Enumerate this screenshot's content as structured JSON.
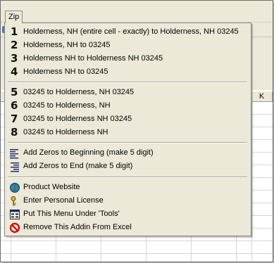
{
  "menubar": {
    "zip_label": "Zip"
  },
  "sheet": {
    "column_header_k": "K"
  },
  "menu": {
    "group1": [
      {
        "number": "1",
        "label": "Holderness, NH (entire cell - exactly) to Holderness, NH 03245"
      },
      {
        "number": "2",
        "label": "Holderness, NH to 03245"
      },
      {
        "number": "3",
        "label": "Holderness NH to Holderness NH 03245"
      },
      {
        "number": "4",
        "label": "Holderness NH to 03245"
      }
    ],
    "group2": [
      {
        "number": "5",
        "label": "03245 to Holderness, NH 03245"
      },
      {
        "number": "6",
        "label": "03245 to Holderness, NH"
      },
      {
        "number": "7",
        "label": "03245 to Holderness NH 03245"
      },
      {
        "number": "8",
        "label": "03245 to Holderness NH"
      }
    ],
    "group3": [
      {
        "icon": "align-left-lines-icon",
        "label": "Add Zeros to Beginning (make 5 digit)"
      },
      {
        "icon": "align-right-lines-icon",
        "label": "Add Zeros to End (make 5 digit)"
      }
    ],
    "group4": [
      {
        "icon": "globe-icon",
        "label": "Product Website"
      },
      {
        "icon": "key-icon",
        "label": "Enter Personal License"
      },
      {
        "icon": "menu-grid-icon",
        "label": "Put This Menu Under 'Tools'"
      },
      {
        "icon": "prohibited-icon",
        "label": "Remove This Addin From Excel"
      }
    ]
  },
  "colors": {
    "menu_background": "#ece9d8",
    "prohibited_red": "#d40000",
    "globe_blue": "#2f6bbf"
  }
}
